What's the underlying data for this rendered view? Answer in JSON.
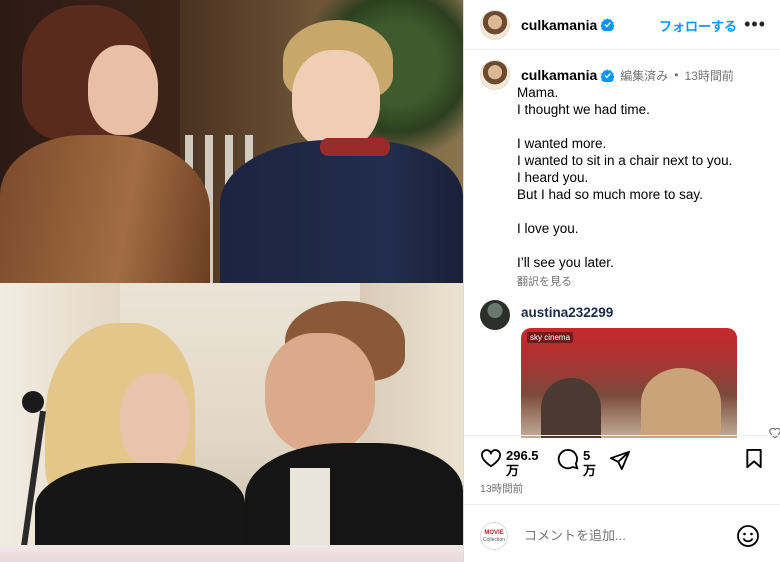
{
  "post": {
    "username": "culkamania",
    "follow_label": "フォローする",
    "more_label": "•••"
  },
  "caption": {
    "username": "culkamania",
    "edited_label": "編集済み",
    "separator": "•",
    "time": "13時間前",
    "lines": [
      "Mama.",
      "I thought we had time.",
      "",
      "I wanted more.",
      "I wanted to sit in a chair next to you.",
      "I heard you.",
      "But I had so much more to say.",
      "",
      "I love you.",
      "",
      "I’ll see you later."
    ],
    "translate_label": "翻訳を見る"
  },
  "comment": {
    "username": "austina232299",
    "gif_tag": "sky cinema"
  },
  "actions": {
    "likes_line1": "296.5",
    "likes_line2": "万",
    "comments_line1": "5",
    "comments_line2": "万"
  },
  "timestamp": "13時間前",
  "add_comment": {
    "placeholder": "コメントを追加...",
    "avatar_text_1": "MOVIE",
    "avatar_text_2": "Collection"
  },
  "colors": {
    "accent": "#0095f6",
    "verified": "#0095f6",
    "secondary_text": "#737373"
  }
}
